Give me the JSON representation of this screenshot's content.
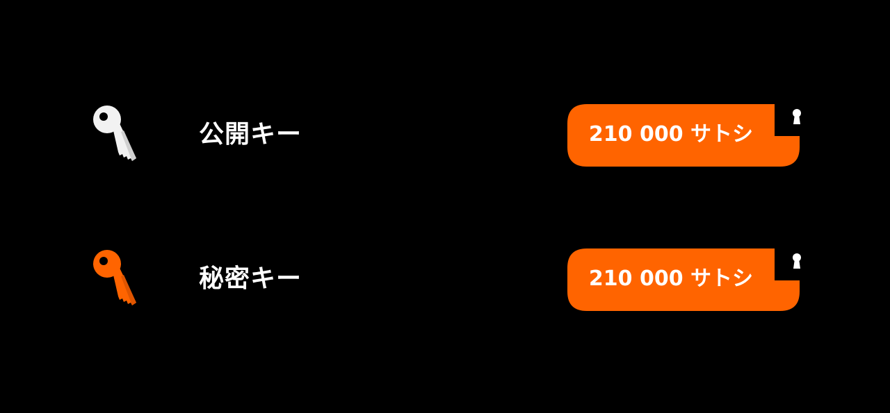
{
  "colors": {
    "background": "#000000",
    "accent": "#FF6400",
    "public_key_icon": "#F2F2F2",
    "private_key_icon": "#FF6400",
    "text": "#FFFFFF"
  },
  "rows": [
    {
      "icon": "key-icon",
      "label": "公開キー",
      "amount": "210 000 サトシ",
      "badge_icon": "keyhole-icon"
    },
    {
      "icon": "key-icon",
      "label": "秘密キー",
      "amount": "210 000 サトシ",
      "badge_icon": "keyhole-icon"
    }
  ]
}
